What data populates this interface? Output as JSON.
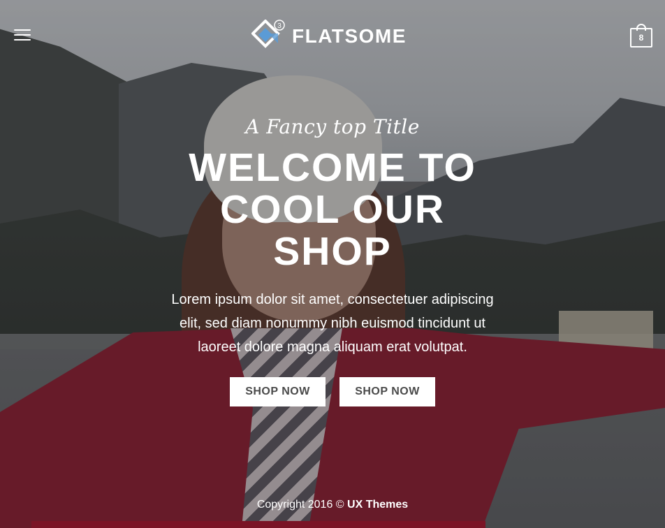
{
  "header": {
    "brand_name": "FLATSOME",
    "brand_version": "3",
    "cart_count": "8"
  },
  "hero": {
    "fancy_title": "A Fancy top Title",
    "headline_lines": [
      "WELCOME TO",
      "COOL OUR",
      "SHOP"
    ],
    "description_lines": [
      "Lorem ipsum dolor sit amet, consectetuer adipiscing",
      "elit, sed diam nonummy nibh euismod tincidunt ut",
      "laoreet dolore magna aliquam erat volutpat."
    ],
    "buttons": [
      {
        "label": "SHOP NOW"
      },
      {
        "label": "SHOP NOW"
      }
    ]
  },
  "footer": {
    "copyright_prefix": "Copyright 2016 ©",
    "company": "UX Themes"
  },
  "icons": {
    "menu": "hamburger-icon",
    "cart": "shopping-bag-icon",
    "logo": "flatsome-logo-icon"
  },
  "colors": {
    "logo_blue": "#5b9bd5",
    "button_bg": "#ffffff",
    "button_text": "#4a4a4a",
    "coat_red": "#8f1f31"
  }
}
